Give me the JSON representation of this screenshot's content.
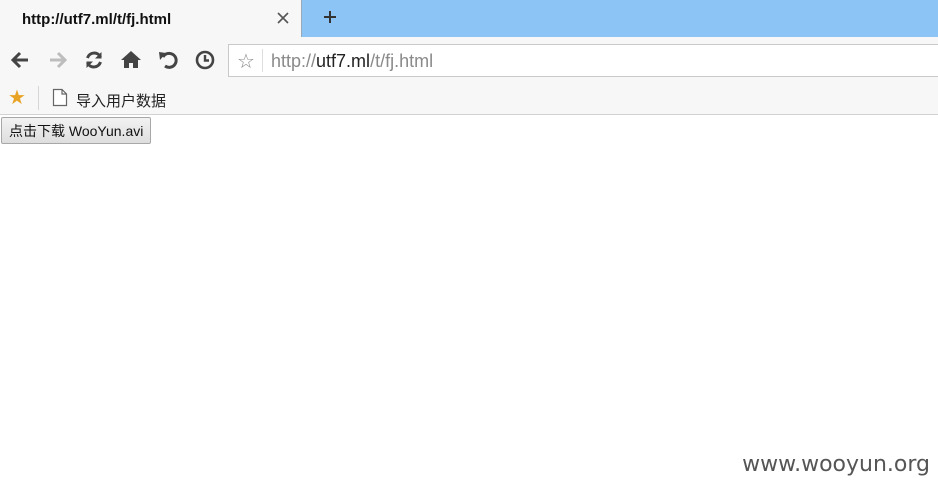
{
  "tab": {
    "title": "http://utf7.ml/t/fj.html"
  },
  "toolbar": {
    "icons": [
      "back-icon",
      "forward-icon",
      "reload-icon",
      "home-icon",
      "undo-icon",
      "history-icon"
    ]
  },
  "address_bar": {
    "url_scheme": "http://",
    "url_host": "utf7.ml",
    "url_path": "/t/fj.html"
  },
  "bookmarks_bar": {
    "items": [
      {
        "label": "导入用户数据"
      }
    ]
  },
  "page": {
    "download_button_label": "点击下载 WooYun.avi",
    "watermark": "www.wooyun.org"
  },
  "colors": {
    "tabstrip": "#8cc4f5",
    "toolbar": "#f7f7f7",
    "bookmark_star": "#e8a325"
  }
}
